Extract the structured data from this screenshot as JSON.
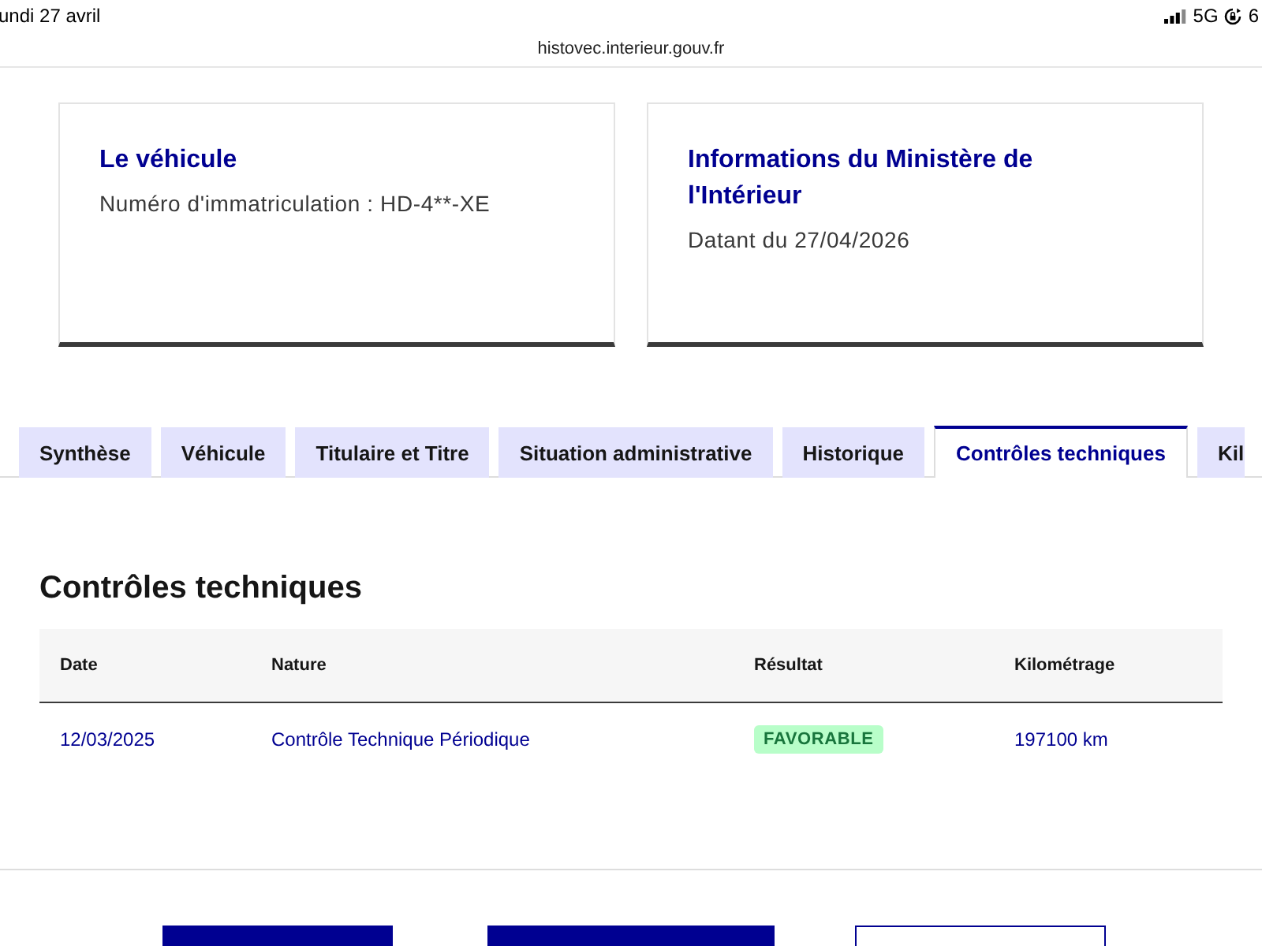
{
  "status_bar": {
    "date": "undi 27 avril",
    "network": "5G",
    "battery": "6"
  },
  "address_bar": {
    "url": "histovec.interieur.gouv.fr"
  },
  "cards": [
    {
      "title": "Le véhicule",
      "text": "Numéro d'immatriculation : HD-4**-XE"
    },
    {
      "title": "Informations du Ministère de l'Intérieur",
      "text": "Datant du 27/04/2026"
    }
  ],
  "tabs": [
    {
      "label": "Synthèse",
      "selected": false
    },
    {
      "label": "Véhicule",
      "selected": false
    },
    {
      "label": "Titulaire et Titre",
      "selected": false
    },
    {
      "label": "Situation administrative",
      "selected": false
    },
    {
      "label": "Historique",
      "selected": false
    },
    {
      "label": "Contrôles techniques",
      "selected": true
    },
    {
      "label": "Kil",
      "selected": false
    }
  ],
  "panel": {
    "heading": "Contrôles techniques",
    "table": {
      "columns": [
        "Date",
        "Nature",
        "Résultat",
        "Kilométrage"
      ],
      "rows": [
        {
          "date": "12/03/2025",
          "nature": "Contrôle Technique Périodique",
          "result": {
            "label": "FAVORABLE",
            "kind": "success"
          },
          "mileage": "197100 km"
        }
      ]
    }
  },
  "buttons": [
    {
      "kind": "primary"
    },
    {
      "kind": "primary"
    },
    {
      "kind": "secondary"
    }
  ]
}
